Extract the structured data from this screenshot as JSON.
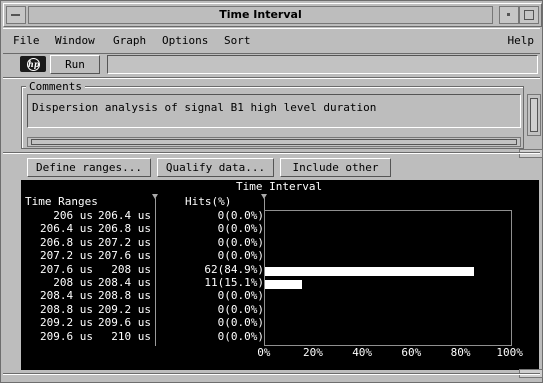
{
  "window": {
    "title": "Time Interval"
  },
  "menu": {
    "file": "File",
    "window": "Window",
    "graph": "Graph",
    "options": "Options",
    "sort": "Sort",
    "help": "Help"
  },
  "toolbar": {
    "logo": "hp",
    "run_label": "Run",
    "run_field": ""
  },
  "comments": {
    "label": "Comments",
    "text": "Dispersion analysis of signal B1 high level duration"
  },
  "actions": {
    "define_ranges": "Define ranges...",
    "qualify_data": "Qualify data...",
    "include_other": "Include other"
  },
  "table": {
    "header_ranges": "Time Ranges",
    "header_hits": "Hits(%)",
    "header_chart": "Time Interval",
    "rows": [
      {
        "from": "206 us",
        "to": "206.4 us",
        "hits": "0(0.0%)",
        "pct": 0
      },
      {
        "from": "206.4 us",
        "to": "206.8 us",
        "hits": "0(0.0%)",
        "pct": 0
      },
      {
        "from": "206.8 us",
        "to": "207.2 us",
        "hits": "0(0.0%)",
        "pct": 0
      },
      {
        "from": "207.2 us",
        "to": "207.6 us",
        "hits": "0(0.0%)",
        "pct": 0
      },
      {
        "from": "207.6 us",
        "to": "208 us",
        "hits": "62(84.9%)",
        "pct": 84.9
      },
      {
        "from": "208 us",
        "to": "208.4 us",
        "hits": "11(15.1%)",
        "pct": 15.1
      },
      {
        "from": "208.4 us",
        "to": "208.8 us",
        "hits": "0(0.0%)",
        "pct": 0
      },
      {
        "from": "208.8 us",
        "to": "209.2 us",
        "hits": "0(0.0%)",
        "pct": 0
      },
      {
        "from": "209.2 us",
        "to": "209.6 us",
        "hits": "0(0.0%)",
        "pct": 0
      },
      {
        "from": "209.6 us",
        "to": "210 us",
        "hits": "0(0.0%)",
        "pct": 0
      }
    ],
    "axis_ticks": [
      "0%",
      "20%",
      "40%",
      "60%",
      "80%",
      "100%"
    ]
  },
  "chart_data": {
    "type": "bar",
    "title": "Time Interval",
    "categories": [
      "206 us - 206.4 us",
      "206.4 us - 206.8 us",
      "206.8 us - 207.2 us",
      "207.2 us - 207.6 us",
      "207.6 us - 208 us",
      "208 us - 208.4 us",
      "208.4 us - 208.8 us",
      "208.8 us - 209.2 us",
      "209.2 us - 209.6 us",
      "209.6 us - 210 us"
    ],
    "values": [
      0,
      0,
      0,
      0,
      84.9,
      15.1,
      0,
      0,
      0,
      0
    ],
    "counts": [
      0,
      0,
      0,
      0,
      62,
      11,
      0,
      0,
      0,
      0
    ],
    "xlim": [
      0,
      100
    ],
    "orientation": "horizontal"
  }
}
